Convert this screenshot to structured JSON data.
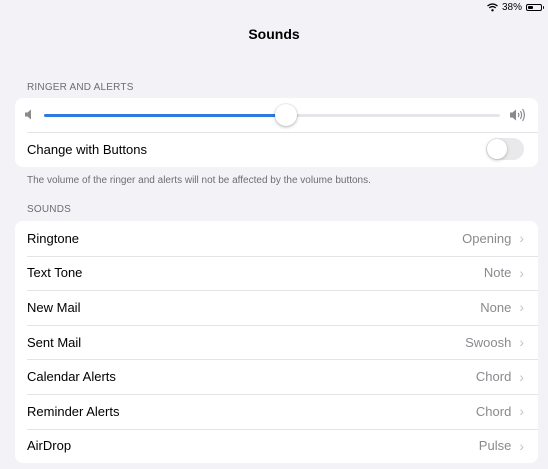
{
  "status": {
    "battery_text": "38%",
    "battery_level": 0.38
  },
  "title": "Sounds",
  "ringer": {
    "header": "RINGER AND ALERTS",
    "volume_level": 0.53,
    "change_with_buttons_label": "Change with Buttons",
    "change_with_buttons_on": false,
    "footer": "The volume of the ringer and alerts will not be affected by the volume buttons."
  },
  "sounds": {
    "header": "SOUNDS",
    "items": [
      {
        "label": "Ringtone",
        "value": "Opening"
      },
      {
        "label": "Text Tone",
        "value": "Note"
      },
      {
        "label": "New Mail",
        "value": "None"
      },
      {
        "label": "Sent Mail",
        "value": "Swoosh"
      },
      {
        "label": "Calendar Alerts",
        "value": "Chord"
      },
      {
        "label": "Reminder Alerts",
        "value": "Chord"
      },
      {
        "label": "AirDrop",
        "value": "Pulse"
      }
    ]
  },
  "colors": {
    "accent": "#2f7ae0",
    "background": "#f2f2f7"
  }
}
